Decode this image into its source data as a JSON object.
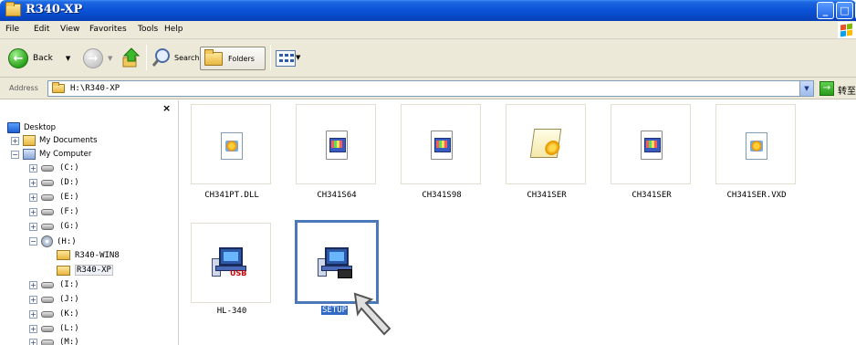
{
  "window": {
    "title": "R340-XP"
  },
  "menu": [
    {
      "label": "File"
    },
    {
      "label": "Edit"
    },
    {
      "label": "View"
    },
    {
      "label": "Favorites"
    },
    {
      "label": "Tools"
    },
    {
      "label": "Help"
    }
  ],
  "toolbar": {
    "back_label": "Back",
    "search_label": "Search",
    "folders_label": "Folders"
  },
  "address": {
    "label": "Address",
    "value": "H:\\R340-XP",
    "go_label": "转至"
  },
  "tree": {
    "desktop": "Desktop",
    "my_documents": "My Documents",
    "my_computer": "My Computer",
    "drives": [
      "(C:)",
      "(D:)",
      "(E:)",
      "(F:)",
      "(G:)",
      "(H:)"
    ],
    "h_children": [
      "R340-WIN8",
      "R340-XP"
    ],
    "drives_after": [
      "(I:)",
      "(J:)",
      "(K:)",
      "(L:)",
      "(M:)"
    ]
  },
  "files": [
    {
      "name": "CH341PT.DLL",
      "icon": "dll-file-icon"
    },
    {
      "name": "CH341S64",
      "icon": "system-file-icon"
    },
    {
      "name": "CH341S98",
      "icon": "system-file-icon"
    },
    {
      "name": "CH341SER",
      "icon": "setup-information-icon"
    },
    {
      "name": "CH341SER",
      "icon": "system-file-icon"
    },
    {
      "name": "CH341SER.VXD",
      "icon": "dll-file-icon"
    },
    {
      "name": "HL-340",
      "icon": "usb-installer-icon"
    },
    {
      "name": "SETUP",
      "icon": "setup-installer-icon"
    }
  ]
}
